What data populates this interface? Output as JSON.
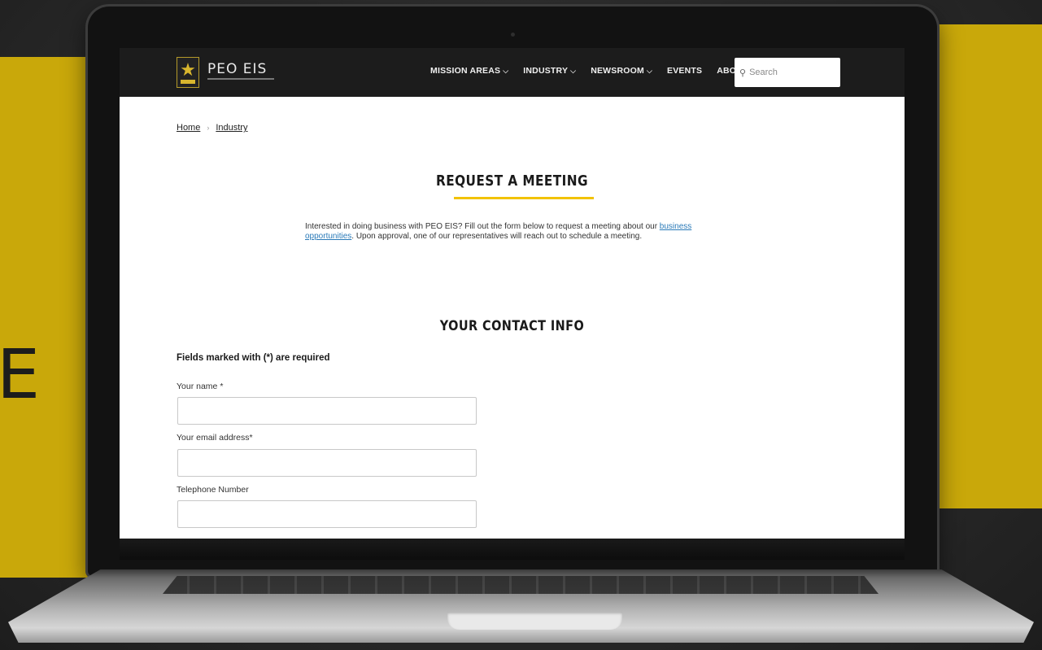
{
  "background": {
    "accent_color": "#c9a80a",
    "side_letter": "E"
  },
  "site": {
    "brand": "PEO EIS",
    "nav": [
      {
        "label": "MISSION AREAS",
        "has_dropdown": true
      },
      {
        "label": "INDUSTRY",
        "has_dropdown": true
      },
      {
        "label": "NEWSROOM",
        "has_dropdown": true
      },
      {
        "label": "EVENTS",
        "has_dropdown": false
      },
      {
        "label": "ABOUT",
        "has_dropdown": true
      }
    ],
    "search": {
      "placeholder": "Search",
      "icon": "search-icon"
    }
  },
  "breadcrumb": {
    "home": "Home",
    "separator": "›",
    "current": "Industry"
  },
  "page": {
    "title": "REQUEST A MEETING",
    "title_underline_color": "#f2c200",
    "intro_before_link": "Interested in doing business with PEO EIS? Fill out the form below to request a meeting about our ",
    "intro_link": "business opportunities",
    "intro_after_link": ". Upon approval, one of our representatives will reach out to schedule a meeting."
  },
  "form": {
    "section_title": "YOUR CONTACT INFO",
    "required_note": "Fields marked with (*) are required",
    "fields": [
      {
        "label": "Your name *",
        "value": ""
      },
      {
        "label": "Your email address*",
        "value": ""
      },
      {
        "label": "Telephone Number",
        "value": ""
      }
    ]
  }
}
